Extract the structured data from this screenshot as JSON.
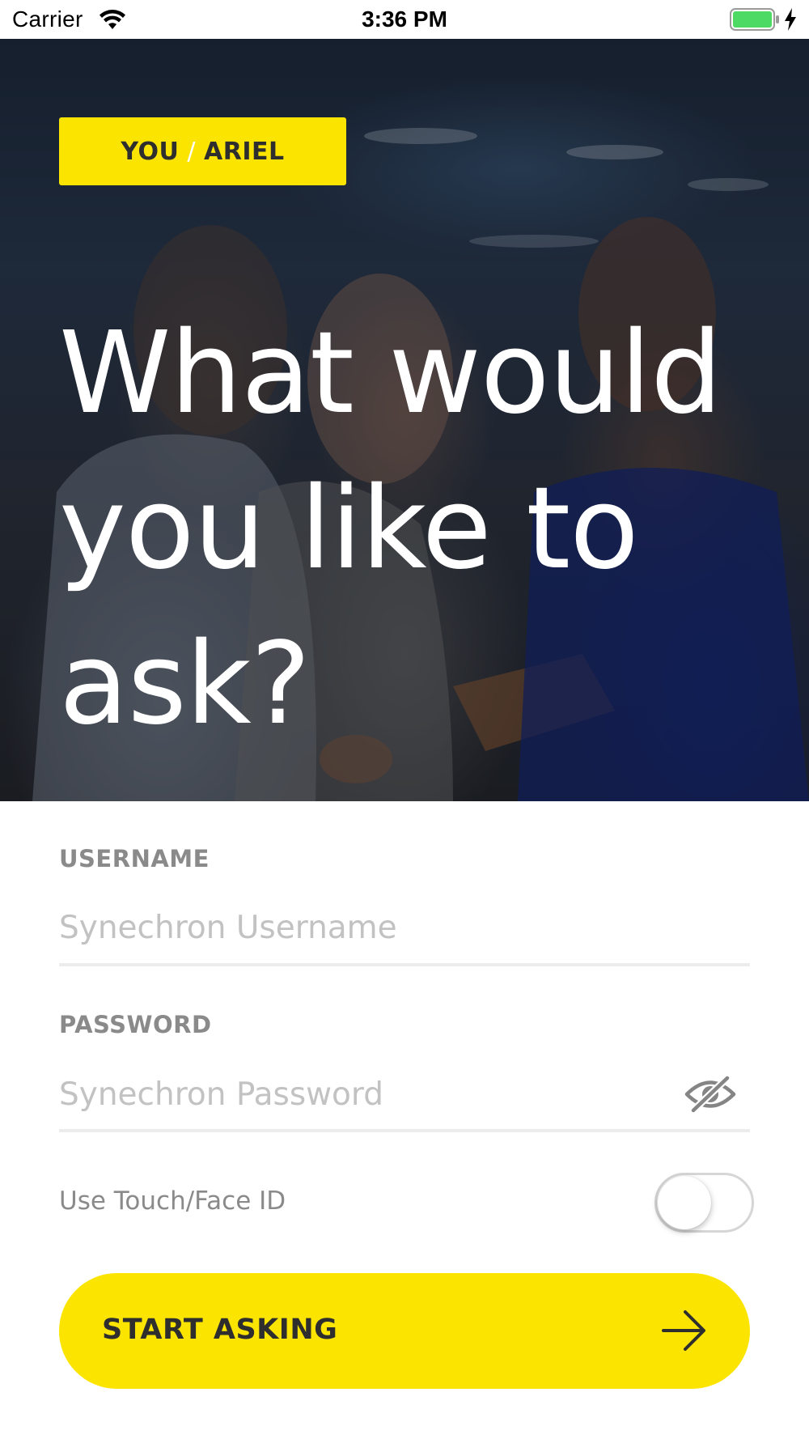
{
  "status_bar": {
    "carrier": "Carrier",
    "time": "3:36 PM",
    "icons": [
      "wifi-icon",
      "battery-icon",
      "charging-bolt-icon"
    ],
    "battery_color": "#4cd964"
  },
  "hero": {
    "badge_left": "YOU",
    "badge_separator": "/",
    "badge_right": "ARIEL",
    "headline": "What would you like to ask?"
  },
  "form": {
    "username": {
      "label": "USERNAME",
      "placeholder": "Synechron Username",
      "value": ""
    },
    "password": {
      "label": "PASSWORD",
      "placeholder": "Synechron Password",
      "value": "",
      "visibility_icon": "eye-slash-icon"
    },
    "touch_id": {
      "label": "Use Touch/Face ID",
      "enabled": false
    },
    "submit": {
      "label": "START ASKING",
      "icon": "arrow-right-icon"
    }
  },
  "colors": {
    "accent": "#fbe500",
    "label_gray": "#8a8a8a",
    "placeholder_gray": "#c2c2c2",
    "dark_text": "#2e2e2e"
  }
}
